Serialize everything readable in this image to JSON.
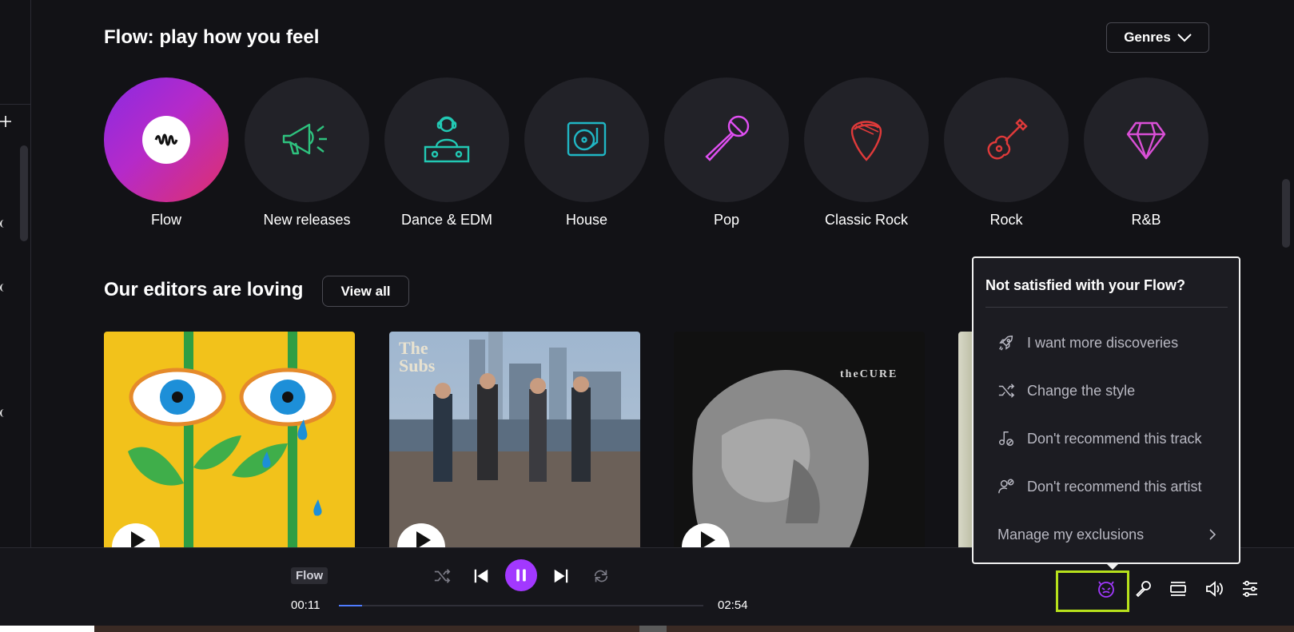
{
  "flow_section": {
    "title": "Flow: play how you feel",
    "genres_button": "Genres",
    "genres": [
      {
        "label": "Flow",
        "icon": "flow-disc-icon"
      },
      {
        "label": "New releases",
        "icon": "megaphone-icon"
      },
      {
        "label": "Dance & EDM",
        "icon": "dj-icon"
      },
      {
        "label": "House",
        "icon": "turntable-icon"
      },
      {
        "label": "Pop",
        "icon": "microphone-icon"
      },
      {
        "label": "Classic Rock",
        "icon": "guitar-pick-icon"
      },
      {
        "label": "Rock",
        "icon": "guitar-icon"
      },
      {
        "label": "R&B",
        "icon": "diamond-icon"
      }
    ]
  },
  "editors_section": {
    "title": "Our editors are loving",
    "view_all": "View all",
    "cards": [
      {
        "art_text": ""
      },
      {
        "art_text": "The Subs"
      },
      {
        "art_text": "theCURE"
      },
      {
        "art_text": ""
      }
    ]
  },
  "popup": {
    "title": "Not satisfied with your Flow?",
    "items": [
      {
        "label": "I want more discoveries",
        "icon": "rocket-icon"
      },
      {
        "label": "Change the style",
        "icon": "shuffle-icon"
      },
      {
        "label": "Don't recommend this track",
        "icon": "note-block-icon"
      },
      {
        "label": "Don't recommend this artist",
        "icon": "user-block-icon"
      }
    ],
    "manage": "Manage my exclusions"
  },
  "player": {
    "context": "Flow",
    "elapsed": "00:11",
    "duration": "02:54",
    "progress_fraction": 0.063,
    "colors": {
      "accent": "#a238ff",
      "progress": "#4f7cff",
      "highlight": "#b7e11c"
    }
  }
}
